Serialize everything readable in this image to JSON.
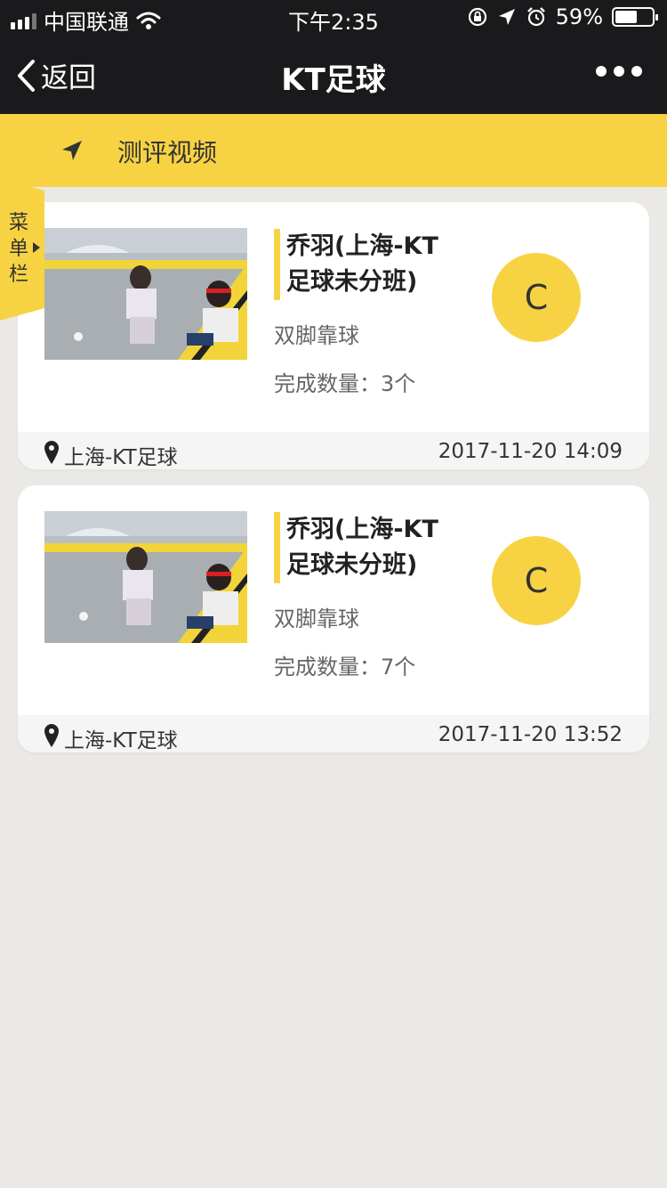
{
  "status_bar": {
    "carrier": "中国联通",
    "time": "下午2:35",
    "battery": "59%",
    "battery_level": 0.59
  },
  "nav": {
    "back_label": "返回",
    "title": "KT足球"
  },
  "header": {
    "label": "测评视频"
  },
  "side_menu": {
    "label": "菜单栏"
  },
  "colors": {
    "accent": "#f7d343",
    "nav_bg": "#1a1a1c",
    "page_bg": "#ebe9e6"
  },
  "records": [
    {
      "title": "乔羽(上海-KT足球未分班)",
      "skill": "双脚靠球",
      "count": "完成数量：3个",
      "grade": "C",
      "location": "上海-KT足球",
      "datetime": "2017-11-20 14:09"
    },
    {
      "title": "乔羽(上海-KT足球未分班)",
      "skill": "双脚靠球",
      "count": "完成数量：7个",
      "grade": "C",
      "location": "上海-KT足球",
      "datetime": "2017-11-20 13:52"
    }
  ]
}
